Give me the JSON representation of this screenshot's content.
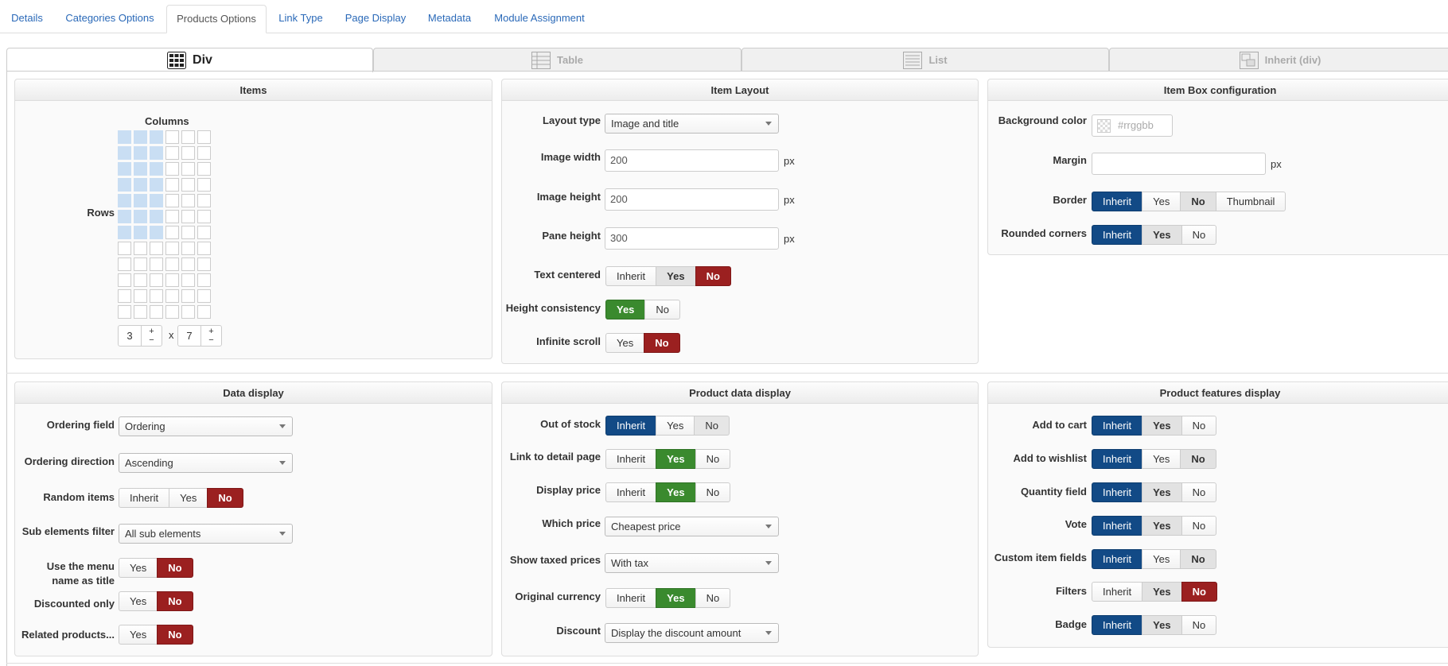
{
  "top_tabs": [
    "Details",
    "Categories Options",
    "Products Options",
    "Link Type",
    "Page Display",
    "Metadata",
    "Module Assignment"
  ],
  "layout_tabs": [
    "Div",
    "Table",
    "List",
    "Inherit (div)"
  ],
  "items": {
    "title": "Items",
    "columns_label": "Columns",
    "rows_label": "Rows",
    "grid_columns": 6,
    "grid_rows": 12,
    "selected_columns": 3,
    "selected_rows": 7,
    "columns_value": "3",
    "rows_value": "7",
    "times": "x",
    "plus": "+",
    "minus": "−"
  },
  "item_layout": {
    "title": "Item Layout",
    "layout_type_label": "Layout type",
    "layout_type_value": "Image and title",
    "image_width_label": "Image width",
    "image_width_value": "200",
    "image_height_label": "Image height",
    "image_height_value": "200",
    "pane_height_label": "Pane height",
    "pane_height_value": "300",
    "unit": "px",
    "text_centered_label": "Text centered",
    "height_consistency_label": "Height consistency",
    "infinite_scroll_label": "Infinite scroll"
  },
  "item_box": {
    "title": "Item Box configuration",
    "background_color_label": "Background color",
    "background_color_placeholder": "#rrggbb",
    "margin_label": "Margin",
    "margin_value": "",
    "unit": "px",
    "border_label": "Border",
    "rounded_corners_label": "Rounded corners"
  },
  "data_display": {
    "title": "Data display",
    "ordering_field_label": "Ordering field",
    "ordering_field_value": "Ordering",
    "ordering_direction_label": "Ordering direction",
    "ordering_direction_value": "Ascending",
    "random_items_label": "Random items",
    "sub_elements_label": "Sub elements filter",
    "sub_elements_value": "All sub elements",
    "menu_name_label_1": "Use the menu",
    "menu_name_label_2": "name as title",
    "discounted_only_label": "Discounted only",
    "related_products_label": "Related products..."
  },
  "product_data": {
    "title": "Product data display",
    "out_of_stock_label": "Out of stock",
    "link_detail_label": "Link to detail page",
    "display_price_label": "Display price",
    "which_price_label": "Which price",
    "which_price_value": "Cheapest price",
    "show_taxed_label": "Show taxed prices",
    "show_taxed_value": "With tax",
    "original_currency_label": "Original currency",
    "discount_label": "Discount",
    "discount_value": "Display the discount amount"
  },
  "product_features": {
    "title": "Product features display",
    "add_to_cart_label": "Add to cart",
    "add_to_wishlist_label": "Add to wishlist",
    "quantity_field_label": "Quantity field",
    "vote_label": "Vote",
    "custom_item_fields_label": "Custom item fields",
    "filters_label": "Filters",
    "badge_label": "Badge"
  },
  "opts": {
    "inherit": "Inherit",
    "yes": "Yes",
    "no": "No",
    "thumbnail": "Thumbnail"
  },
  "colors": {
    "link": "#2a69b8",
    "inherit_active": "#124a86",
    "yes_active": "#3a8a2e",
    "no_active": "#9b2020"
  }
}
